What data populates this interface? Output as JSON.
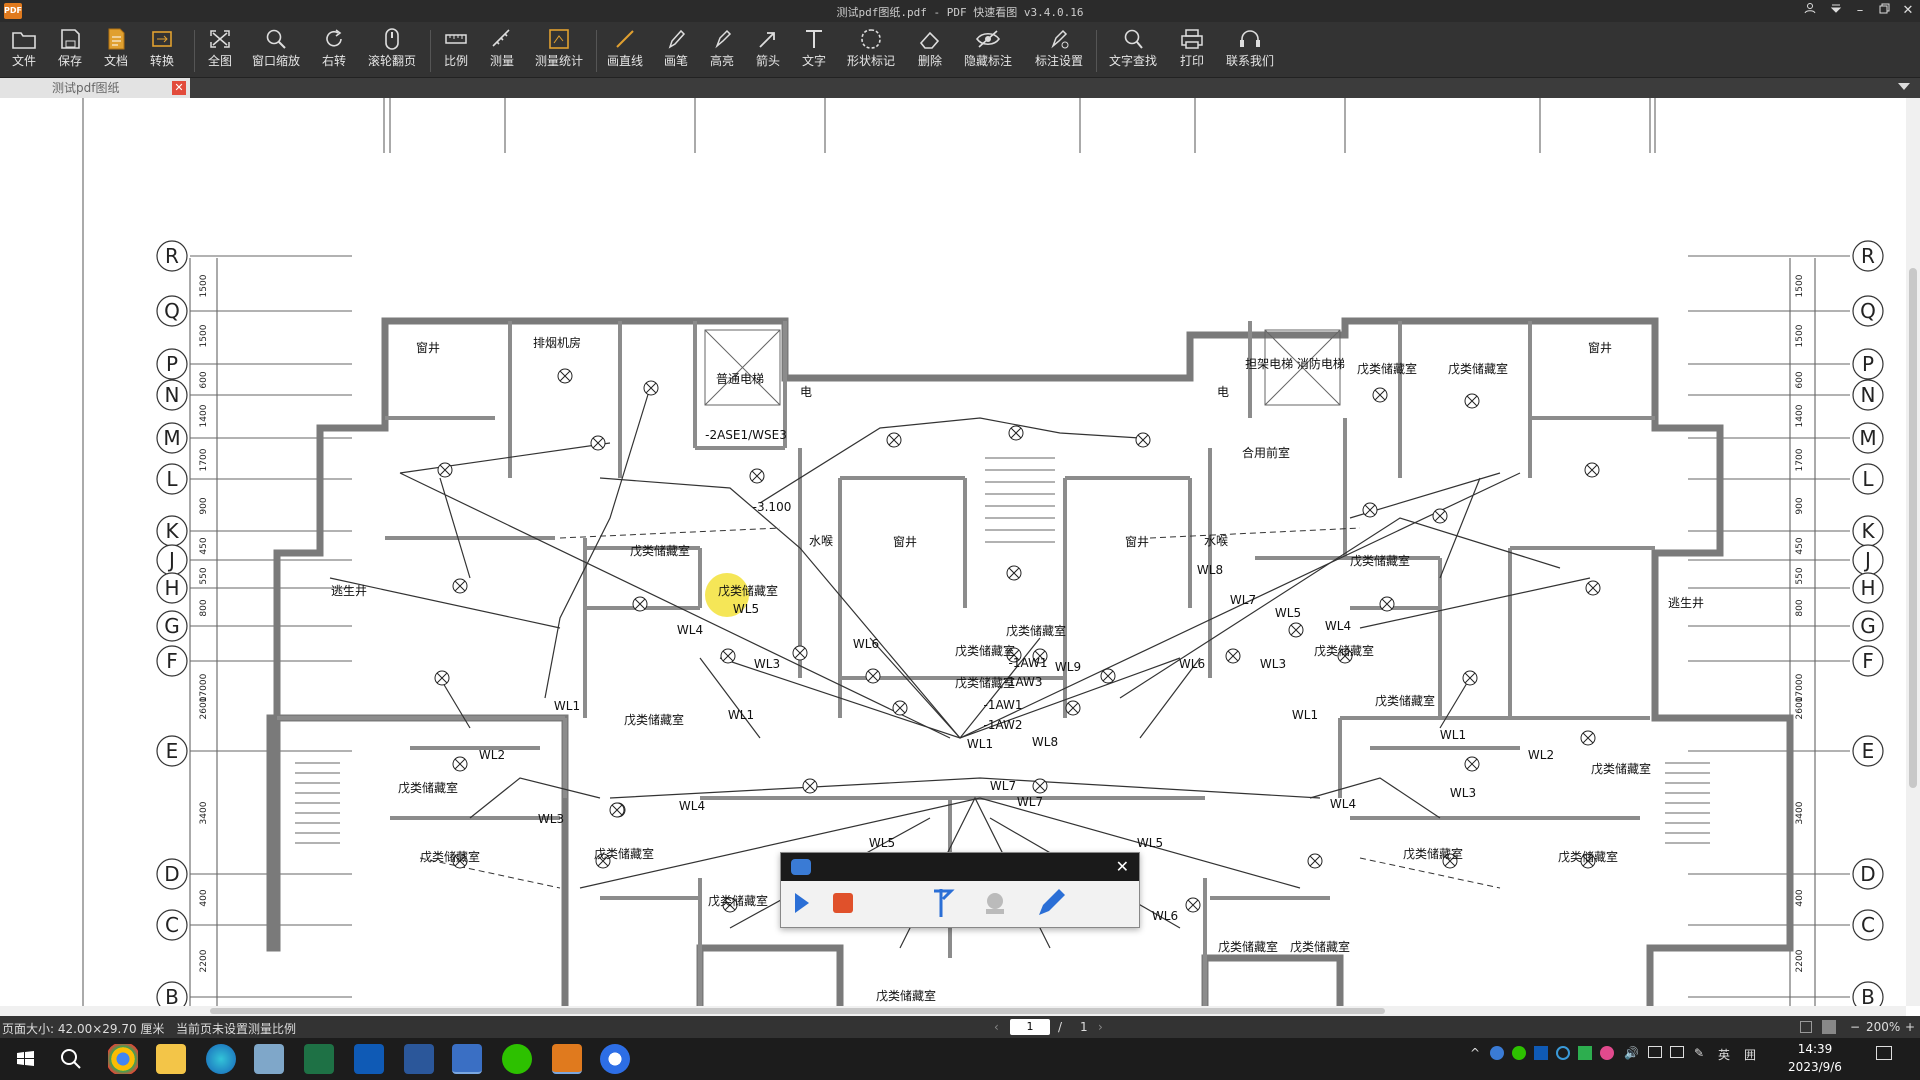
{
  "window": {
    "title": "测试pdf图纸.pdf - PDF 快速看图 v3.4.0.16",
    "app_icon_text": "PDF"
  },
  "toolbar": {
    "items": [
      {
        "label": "文件",
        "icon": "folder-icon"
      },
      {
        "label": "保存",
        "icon": "save-icon"
      },
      {
        "label": "文档",
        "icon": "document-icon"
      },
      {
        "label": "转换",
        "icon": "convert-icon"
      },
      {
        "label": "全图",
        "icon": "fit-all-icon"
      },
      {
        "label": "窗口缩放",
        "icon": "zoom-window-icon"
      },
      {
        "label": "右转",
        "icon": "rotate-right-icon"
      },
      {
        "label": "滚轮翻页",
        "icon": "mouse-wheel-icon"
      },
      {
        "label": "比例",
        "icon": "scale-icon"
      },
      {
        "label": "测量",
        "icon": "measure-icon"
      },
      {
        "label": "测量统计",
        "icon": "measure-stats-icon"
      },
      {
        "label": "画直线",
        "icon": "line-icon"
      },
      {
        "label": "画笔",
        "icon": "pen-icon"
      },
      {
        "label": "高亮",
        "icon": "highlight-icon"
      },
      {
        "label": "箭头",
        "icon": "arrow-icon"
      },
      {
        "label": "文字",
        "icon": "text-icon"
      },
      {
        "label": "形状标记",
        "icon": "shape-mark-icon"
      },
      {
        "label": "删除",
        "icon": "eraser-icon"
      },
      {
        "label": "隐藏标注",
        "icon": "hide-annotation-icon"
      },
      {
        "label": "标注设置",
        "icon": "annotation-settings-icon"
      },
      {
        "label": "文字查找",
        "icon": "text-search-icon"
      },
      {
        "label": "打印",
        "icon": "print-icon"
      },
      {
        "label": "联系我们",
        "icon": "headset-icon"
      }
    ]
  },
  "tabs": [
    {
      "label": "测试pdf图纸",
      "close": "✕"
    }
  ],
  "drawing": {
    "grid_axes_left": [
      "R",
      "Q",
      "P",
      "N",
      "M",
      "L",
      "K",
      "J",
      "H",
      "G",
      "F",
      "E",
      "D",
      "C",
      "B"
    ],
    "grid_axes_right": [
      "R",
      "Q",
      "P",
      "N",
      "M",
      "L",
      "K",
      "J",
      "H",
      "G",
      "F",
      "E",
      "D",
      "C",
      "B"
    ],
    "dims_left": [
      "1500",
      "1500",
      "600",
      "1400",
      "1700",
      "900",
      "450",
      "550",
      "800",
      "17000",
      "2600",
      "3400",
      "400",
      "2200"
    ],
    "room_labels": {
      "shaft_nw": "窗井",
      "exhaust_room": "排烟机房",
      "elevator_normal": "普通电梯",
      "elec_left": "电",
      "panel_label": "-2ASE1/WSE3",
      "level_label": "-3.100",
      "water_well_left": "水喉",
      "shaft_center_left": "窗井",
      "shaft_center_right": "窗井",
      "water_well_right": "水喉",
      "wl8": "WL8",
      "wl7": "WL7",
      "wl5_r": "WL5",
      "wl4_r": "WL4",
      "elevator_fire": "担架电梯 消防电梯",
      "elec_right": "电",
      "shared_hall": "合用前室",
      "storage_1": "戊类储藏室",
      "storage_2": "戊类储藏室",
      "shaft_ne": "窗井",
      "escape_left": "逃生井",
      "escape_right": "逃生井",
      "storage_3": "戊类储藏室",
      "storage_4": "戊类储藏室",
      "storage_5": "戊类储藏室",
      "storage_6": "戊类储藏室",
      "storage_7": "戊类储藏室",
      "storage_8": "戊类储藏室",
      "storage_9": "戊类储藏室",
      "storage_10": "戊类储藏室",
      "storage_11": "戊类储藏室",
      "storage_12": "戊类储藏室",
      "storage_13": "戊类储藏室",
      "storage_14": "戊类储藏室",
      "storage_15": "戊类储藏室",
      "storage_16": "戊类储藏室",
      "storage_17": "戊类储藏室",
      "storage_18": "戊类储藏室",
      "storage_19": "戊类储藏室",
      "storage_20": "戊类储藏室",
      "storage_21": "戊类储藏室",
      "wl1_a": "WL1",
      "wl1_b": "WL1",
      "wl1_c": "WL1",
      "wl1_d": "WL1",
      "wl1_e": "WL1",
      "wl2_l": "WL2",
      "wl2_r": "WL2",
      "wl3_a": "WL3",
      "wl3_b": "WL3",
      "wl3_c": "WL3",
      "wl3_d": "WL3",
      "wl4_a": "WL4",
      "wl4_b": "WL4",
      "wl4_c": "WL4",
      "wl5_a": "WL5",
      "wl5_b": "WL5",
      "wl5_c": "WL5",
      "wl6_a": "WL6",
      "wl6_b": "WL6",
      "wl6_c": "WL6",
      "wl7_a": "WL7",
      "wl7_b": "WL7",
      "wl8_a": "WL8",
      "wl9": "WL9",
      "aw1_a": "-1AW1",
      "aw1_b": "-1AW1",
      "aw2": "-1AW2",
      "aw3": "-1AW3"
    }
  },
  "recorder": {
    "title_icon": "camera-icon",
    "close": "✕"
  },
  "status": {
    "page_size": "页面大小: 42.00×29.70 厘米",
    "scale_note": "当前页未设置测量比例",
    "page_current": "1",
    "page_sep": "/",
    "page_total": "1",
    "zoom": "200%"
  },
  "taskbar": {
    "time": "14:39",
    "date": "2023/9/6",
    "ime": "英",
    "ime2": "囲"
  }
}
